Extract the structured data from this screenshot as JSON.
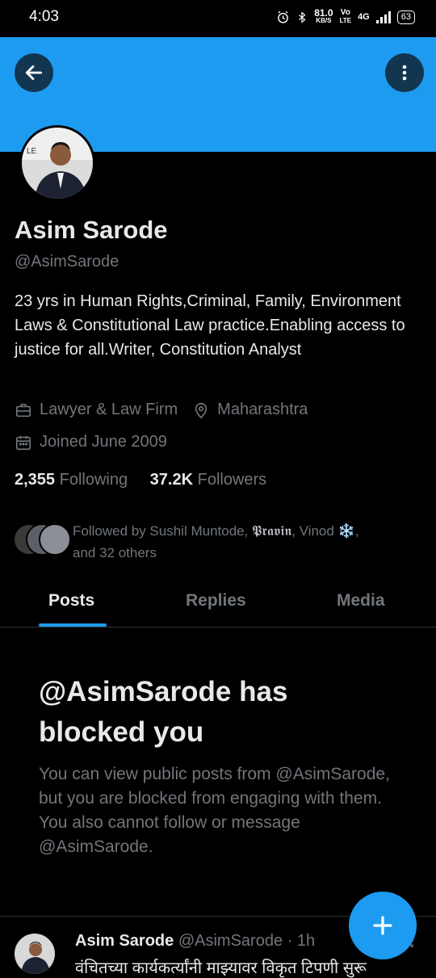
{
  "status_bar": {
    "time": "4:03",
    "network_speed": "81.0",
    "network_unit": "KB/S",
    "volte_top": "Vo",
    "volte_bottom": "LTE",
    "network_type": "4G",
    "battery": "63"
  },
  "profile": {
    "name": "Asim Sarode",
    "handle": "@AsimSarode",
    "bio": "23 yrs in Human Rights,Criminal, Family, Environment Laws & Constitutional Law practice.Enabling access to justice for all.Writer, Constitution Analyst",
    "category": "Lawyer & Law Firm",
    "location": "Maharashtra",
    "joined": "Joined June 2009",
    "following_count": "2,355",
    "following_label": "Following",
    "followers_count": "37.2K",
    "followers_label": "Followers",
    "followed_by_prefix": "Followed by Sushil Muntode, ",
    "followed_by_stylized": "𝕻𝖗𝖆𝖛𝖎𝖓",
    "followed_by_mid": ", Vinod ",
    "followed_by_emoji": "❄️",
    "followed_by_suffix": ",",
    "followed_by_others": "and 32 others"
  },
  "tabs": [
    {
      "label": "Posts",
      "active": true
    },
    {
      "label": "Replies",
      "active": false
    },
    {
      "label": "Media",
      "active": false
    }
  ],
  "blocked": {
    "title": "@AsimSarode has blocked you",
    "text": "You can view public posts from @AsimSarode, but you are blocked from engaging with them. You also cannot follow or message @AsimSarode."
  },
  "post": {
    "author": "Asim Sarode",
    "handle": "@AsimSarode",
    "separator": "·",
    "time": "1h",
    "text": "वंचितच्या कार्यकर्त्यांनी माझ्यावर विकृत टिपणी सुरू"
  },
  "colors": {
    "accent": "#1d9bf0",
    "background": "#000000",
    "text_primary": "#e7e9ea",
    "text_secondary": "#71767b"
  },
  "icons": {
    "back": "arrow-left-icon",
    "more": "more-vertical-icon",
    "category": "briefcase-icon",
    "location": "location-pin-icon",
    "joined": "calendar-icon",
    "compose": "plus-icon"
  }
}
